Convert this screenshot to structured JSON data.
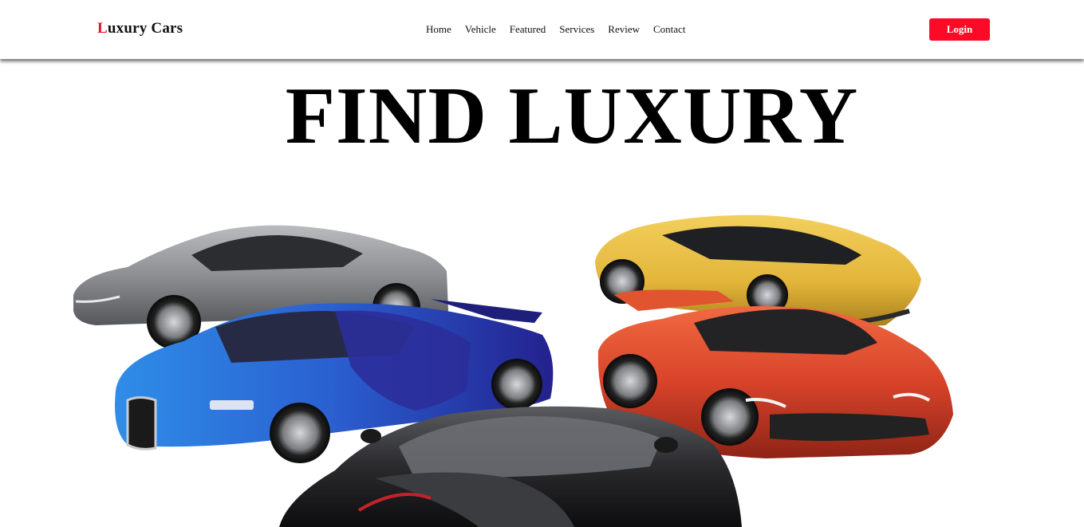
{
  "brand": {
    "initial": "L",
    "rest": "uxury Cars"
  },
  "nav": [
    "Home",
    "Vehicle",
    "Featured",
    "Services",
    "Review",
    "Contact"
  ],
  "login_label": "Login",
  "hero": {
    "title": "FIND LUXURY"
  },
  "colors": {
    "accent": "#ff0a26",
    "text": "#111111",
    "background": "#ffffff"
  },
  "cars": [
    {
      "name": "silver-grand-tourer",
      "color": "#8d8f93"
    },
    {
      "name": "yellow-supercar",
      "color": "#e3b53a"
    },
    {
      "name": "blue-hypercar",
      "color": "#2a5fd0"
    },
    {
      "name": "red-supercar",
      "color": "#d8432a"
    },
    {
      "name": "black-roadster",
      "color": "#2a2a2d"
    }
  ]
}
